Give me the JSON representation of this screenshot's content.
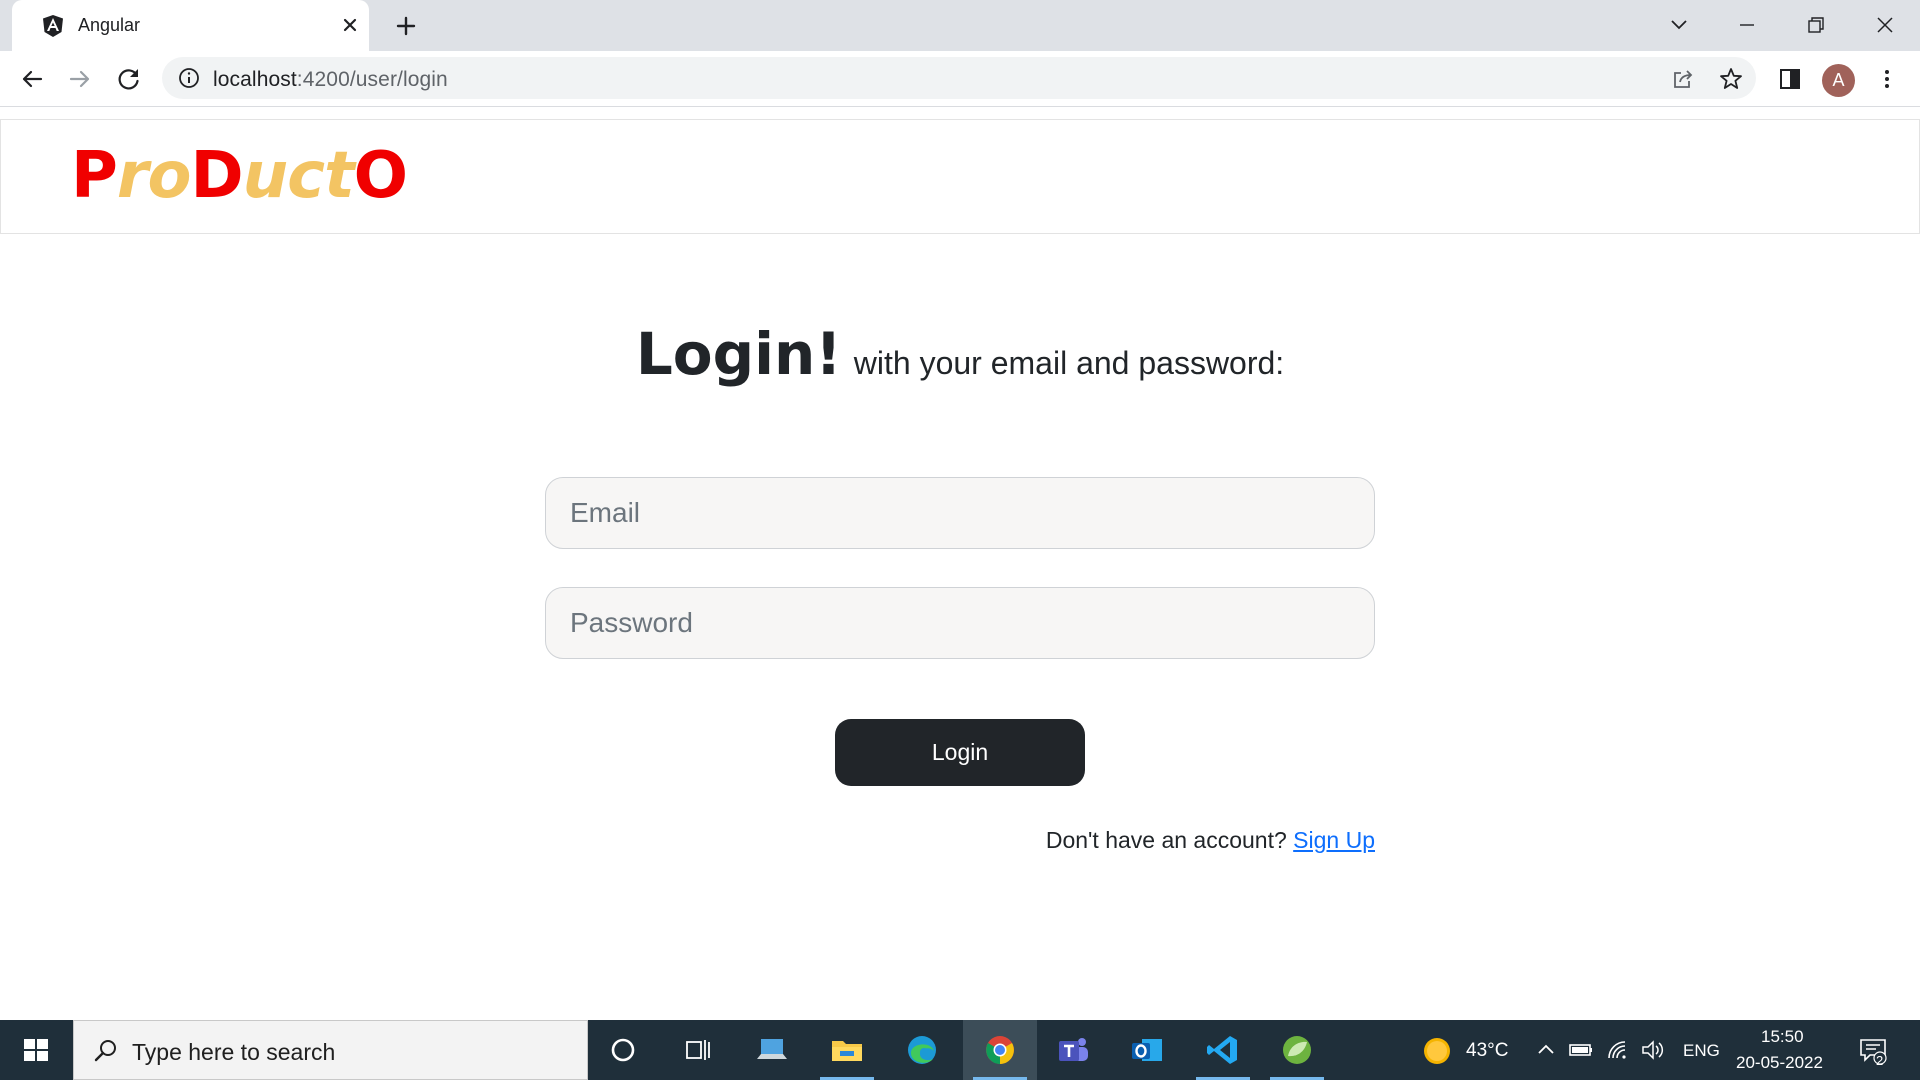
{
  "browser": {
    "tab_title": "Angular",
    "url_host": "localhost",
    "url_rest": ":4200/user/login",
    "profile_initial": "A"
  },
  "page": {
    "brand": {
      "letters": [
        "P",
        "ro",
        "D",
        "uct",
        "O"
      ]
    },
    "heading": {
      "main": "Login!",
      "sub": "with your email and password:"
    },
    "form": {
      "email_placeholder": "Email",
      "password_placeholder": "Password",
      "login_label": "Login"
    },
    "signup": {
      "prompt": "Don't have an account?",
      "link_label": "Sign Up"
    },
    "colors": {
      "brand_red": "#f00000",
      "brand_yellow": "#f3c463",
      "button_dark": "#212529",
      "link_blue": "#0d6efd"
    }
  },
  "taskbar": {
    "search_placeholder": "Type here to search",
    "weather": "43°C",
    "language": "ENG",
    "time": "15:50",
    "date": "20-05-2022",
    "notification_count": "2",
    "apps": [
      "cortana-icon",
      "task-view-icon",
      "laptop-icon",
      "file-explorer-icon",
      "edge-icon",
      "chrome-icon",
      "teams-icon",
      "outlook-icon",
      "vscode-icon",
      "spring-icon"
    ]
  }
}
